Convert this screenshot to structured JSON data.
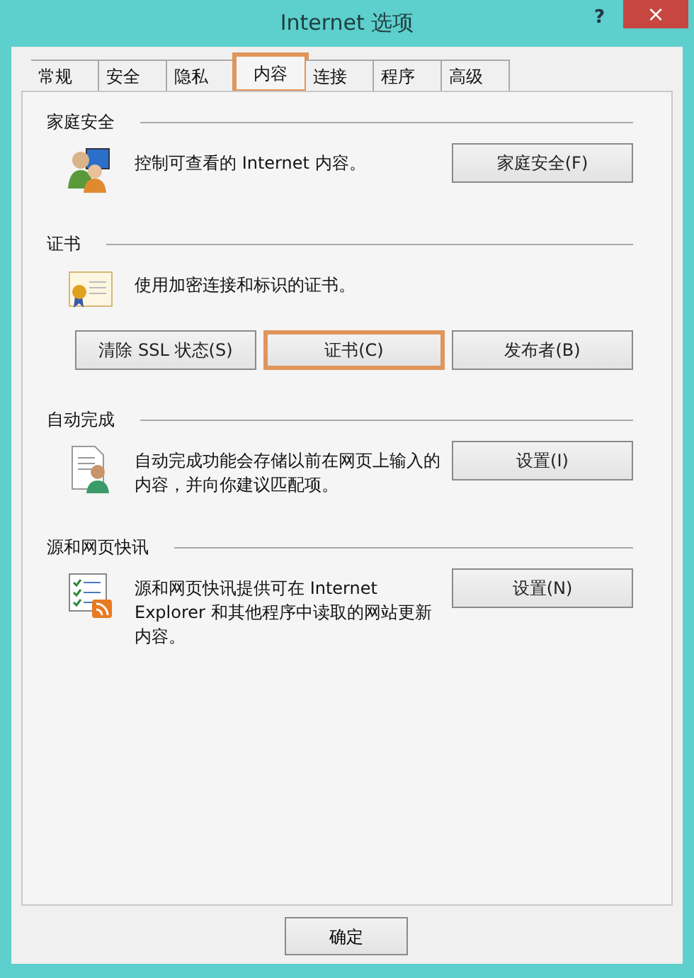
{
  "window": {
    "title": "Internet 选项",
    "help": "?",
    "close": "×"
  },
  "tabs": [
    {
      "label": "常规",
      "selected": false,
      "highlighted": false
    },
    {
      "label": "安全",
      "selected": false,
      "highlighted": false
    },
    {
      "label": "隐私",
      "selected": false,
      "highlighted": false
    },
    {
      "label": "内容",
      "selected": true,
      "highlighted": true
    },
    {
      "label": "连接",
      "selected": false,
      "highlighted": false
    },
    {
      "label": "程序",
      "selected": false,
      "highlighted": false
    },
    {
      "label": "高级",
      "selected": false,
      "highlighted": false
    }
  ],
  "sections": [
    {
      "title": "家庭安全",
      "description": "控制可查看的 Internet 内容。",
      "buttons": [
        {
          "label": "家庭安全(F)",
          "highlighted": false
        }
      ]
    },
    {
      "title": "证书",
      "description": "使用加密连接和标识的证书。",
      "buttons": [
        {
          "label": "清除 SSL 状态(S)",
          "highlighted": false
        },
        {
          "label": "证书(C)",
          "highlighted": true
        },
        {
          "label": "发布者(B)",
          "highlighted": false
        }
      ]
    },
    {
      "title": "自动完成",
      "description": "自动完成功能会存储以前在网页上输入的内容，并向你建议匹配项。",
      "buttons": [
        {
          "label": "设置(I)",
          "highlighted": false
        }
      ]
    },
    {
      "title": "源和网页快讯",
      "description": "源和网页快讯提供可在 Internet Explorer 和其他程序中读取的网站更新内容。",
      "buttons": [
        {
          "label": "设置(N)",
          "highlighted": false
        }
      ]
    }
  ],
  "footer_buttons": [
    "确定"
  ]
}
